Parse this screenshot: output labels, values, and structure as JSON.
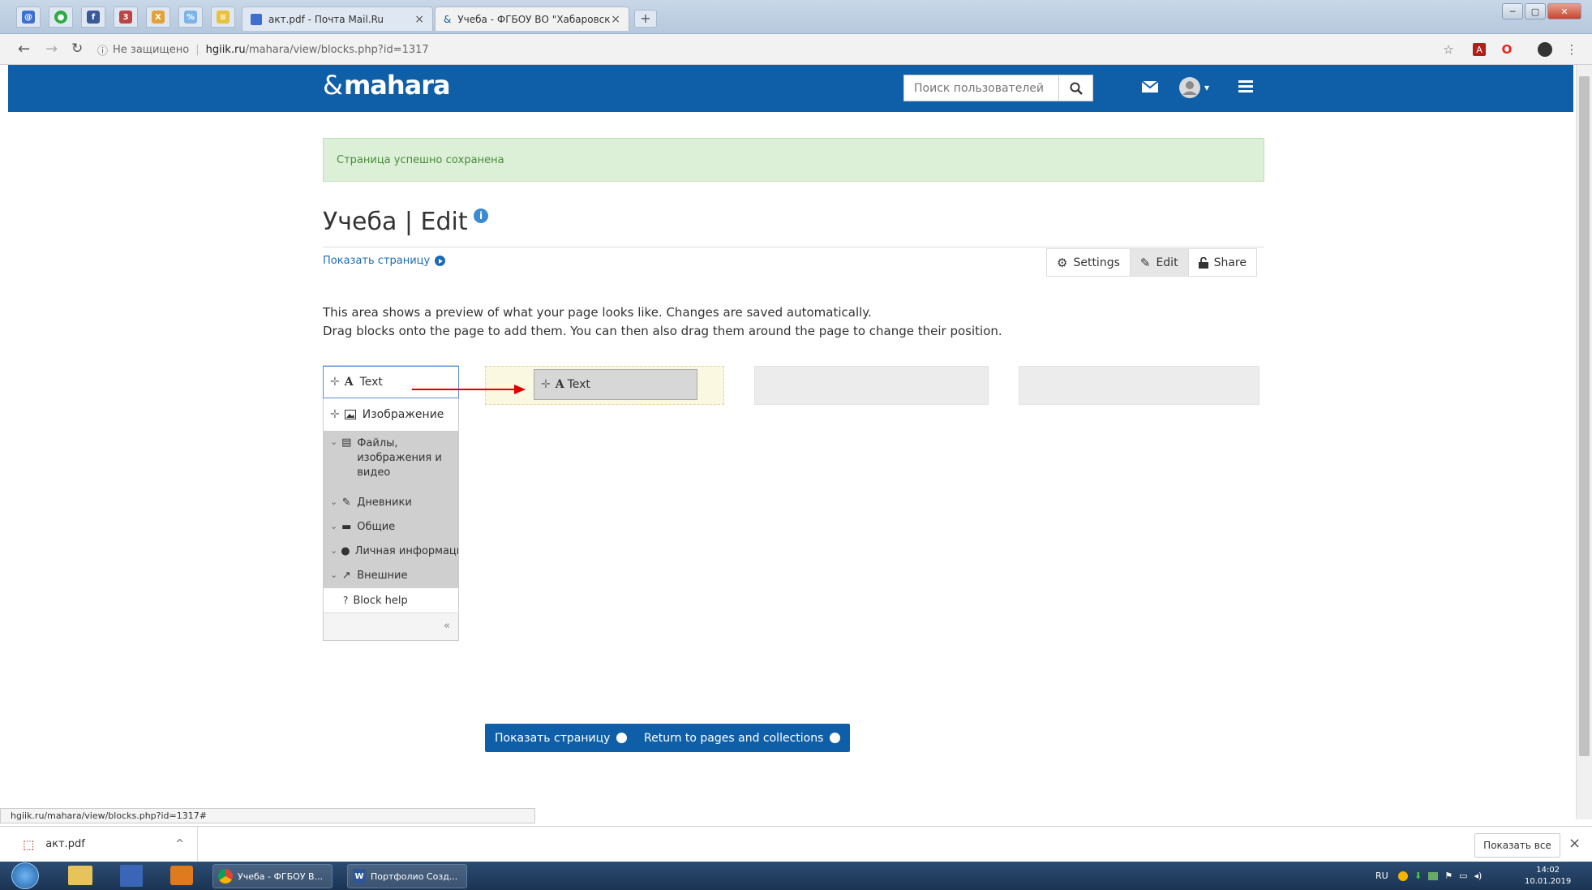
{
  "browser": {
    "tabs": [
      {
        "label": "акт.pdf - Почта Mail.Ru"
      },
      {
        "label": "Учеба - ФГБОУ ВО \"Хабаровск"
      }
    ],
    "new_tab": "+",
    "address": {
      "security": "Не защищено",
      "host": "hgiik.ru",
      "path": "/mahara/view/blocks.php?id=1317"
    },
    "status_url": "hgiik.ru/mahara/view/blocks.php?id=1317#"
  },
  "site": {
    "logo": "mahara",
    "search": {
      "placeholder": "Поиск пользователей"
    }
  },
  "page": {
    "success_message": "Страница успешно сохранена",
    "title": "Учеба | Edit",
    "show_page_link": "Показать страницу",
    "tabs": {
      "settings": "Settings",
      "edit": "Edit",
      "share": "Share"
    },
    "description_line1": "This area shows a preview of what your page looks like. Changes are saved automatically.",
    "description_line2": "Drag blocks onto the page to add them. You can then also drag them around the page to change their position."
  },
  "palette": {
    "items": [
      {
        "label": "Text"
      },
      {
        "label": "Изображение"
      }
    ],
    "categories": [
      {
        "label_lines": [
          "Файлы,",
          "изображения и",
          "видео"
        ]
      },
      {
        "label": "Дневники"
      },
      {
        "label": "Общие"
      },
      {
        "label": "Личная информаци"
      },
      {
        "label": "Внешние"
      }
    ],
    "help": "Block help",
    "collapse": "«"
  },
  "drag_block": {
    "label": "Text"
  },
  "buttons": {
    "show_page": "Показать страницу",
    "return": "Return to pages and collections"
  },
  "downloads": {
    "file": "акт.pdf",
    "show_all": "Показать все"
  },
  "taskbar": {
    "apps": [
      {
        "label": "Учеба - ФГБОУ В..."
      },
      {
        "label": "Портфолио Созд..."
      }
    ],
    "lang": "RU",
    "time": "14:02",
    "date": "10.01.2019"
  },
  "colors": {
    "brand": "#0f5fa8",
    "success_bg": "#dcf0d8",
    "link": "#1a6bb5",
    "arrow": "#e00000"
  }
}
